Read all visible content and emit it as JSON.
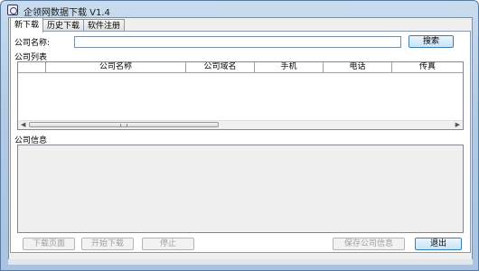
{
  "window": {
    "title": "企领网数据下载 V1.4"
  },
  "tabs": [
    {
      "label": "新下载"
    },
    {
      "label": "历史下载"
    },
    {
      "label": "软件注册"
    }
  ],
  "search": {
    "label": "公司名称:",
    "value": "",
    "button_label": "搜索"
  },
  "company_list": {
    "label": "公司列表",
    "columns": [
      "公司名称",
      "公司域名",
      "手机",
      "电话",
      "传真"
    ],
    "rows": []
  },
  "company_info": {
    "label": "公司信息",
    "value": ""
  },
  "buttons": {
    "download_page": "下载页面",
    "start_download": "开始下载",
    "stop": "停止",
    "save_info": "保存公司信息",
    "exit": "退出"
  },
  "colors": {
    "title_bar": "#b3cbe4",
    "panel": "#ffffff",
    "disabled_text": "#a0a0a0"
  }
}
